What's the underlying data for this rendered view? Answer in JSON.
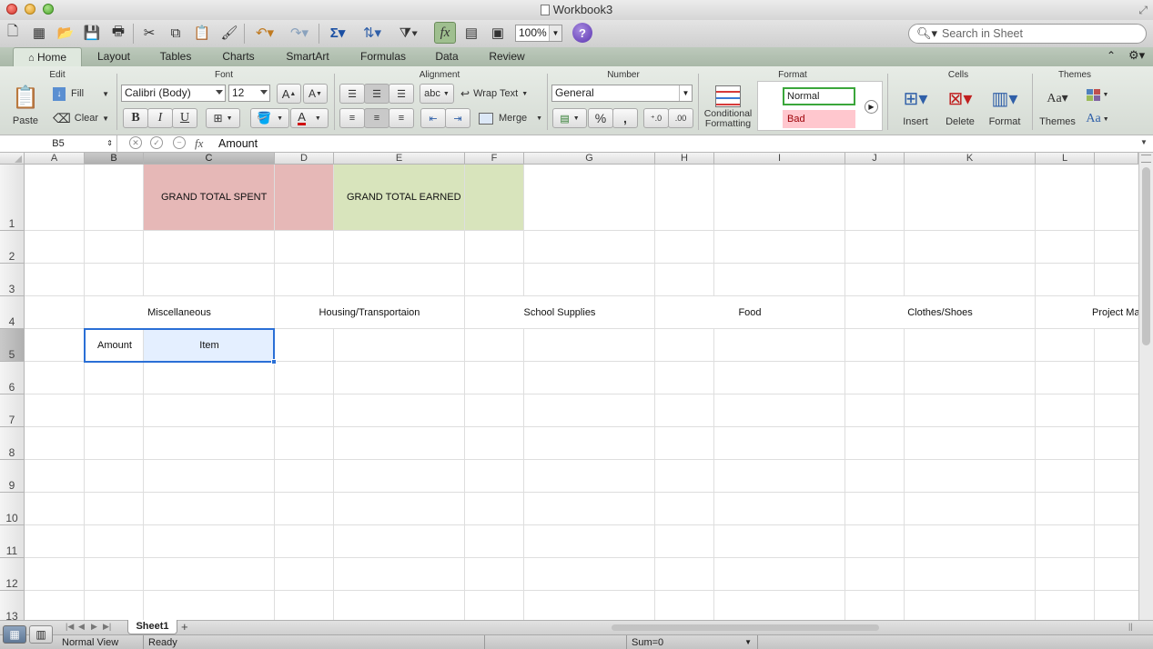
{
  "window": {
    "title": "Workbook3"
  },
  "toolbar": {
    "zoom": "100%",
    "search_placeholder": "Search in Sheet"
  },
  "tabs": [
    {
      "label": "Home"
    },
    {
      "label": "Layout"
    },
    {
      "label": "Tables"
    },
    {
      "label": "Charts"
    },
    {
      "label": "SmartArt"
    },
    {
      "label": "Formulas"
    },
    {
      "label": "Data"
    },
    {
      "label": "Review"
    }
  ],
  "ribbon": {
    "groups": {
      "edit": "Edit",
      "font": "Font",
      "alignment": "Alignment",
      "number": "Number",
      "format": "Format",
      "cells": "Cells",
      "themes": "Themes"
    },
    "paste": "Paste",
    "fill": "Fill",
    "clear": "Clear",
    "font_name": "Calibri (Body)",
    "font_size": "12",
    "bold": "B",
    "italic": "I",
    "underline": "U",
    "wrap_text": "Wrap Text",
    "merge": "Merge",
    "orientation": "abc",
    "number_format": "General",
    "percent": "%",
    "comma": ",",
    "conditional_formatting": "Conditional Formatting",
    "style_normal": "Normal",
    "style_bad": "Bad",
    "insert": "Insert",
    "delete": "Delete",
    "format": "Format",
    "themes": "Themes",
    "aa": "Aa",
    "inc_font": "A",
    "dec_font": "A"
  },
  "formula_bar": {
    "name_box": "B5",
    "fx": "fx",
    "value": "Amount"
  },
  "grid": {
    "columns": [
      "A",
      "B",
      "C",
      "D",
      "E",
      "F",
      "G",
      "H",
      "I",
      "J",
      "K",
      "L"
    ],
    "rows": [
      "1",
      "2",
      "3",
      "4",
      "5",
      "6",
      "7",
      "8",
      "9",
      "10",
      "11",
      "12",
      "13"
    ],
    "cells": {
      "c1": "GRAND TOTAL SPENT",
      "e1": "GRAND TOTAL EARNED",
      "bc4": "Miscellaneous",
      "de4": "Housing/Transportaion",
      "fg4": "School Supplies",
      "hi4": "Food",
      "jk4": "Clothes/Shoes",
      "l4": "Project Ma",
      "b5": "Amount",
      "c5": "Item"
    }
  },
  "colors": {
    "spent_fill": "#e6b8b7",
    "earned_fill": "#d8e4bc",
    "selection": "#2a6fd6",
    "selected_fill": "#e4efff"
  },
  "sheet_tabs": {
    "sheet1": "Sheet1"
  },
  "status": {
    "view": "Normal View",
    "state": "Ready",
    "sum": "Sum=0"
  }
}
